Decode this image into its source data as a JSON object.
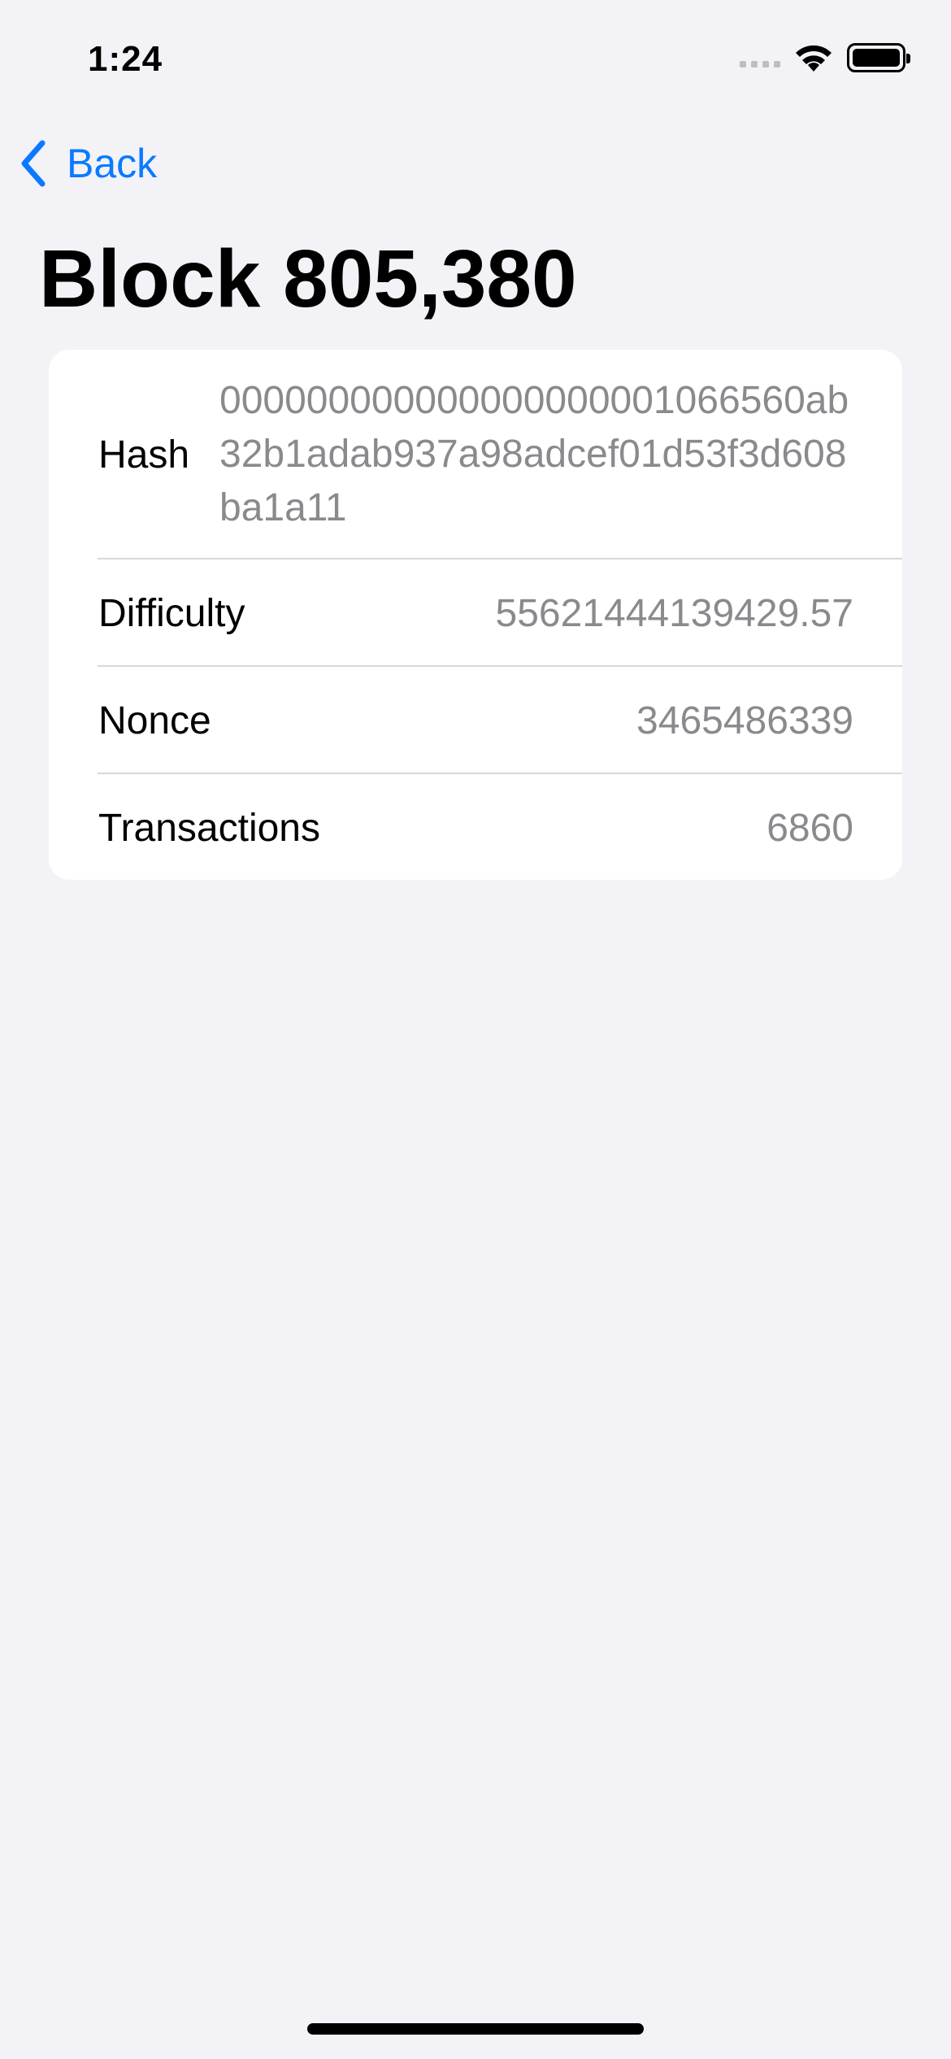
{
  "status_bar": {
    "time": "1:24"
  },
  "nav": {
    "back_label": "Back"
  },
  "title": "Block 805,380",
  "details": [
    {
      "label": "Hash",
      "value": "000000000000000000001066560ab32b1adab937a98adcef01d53f3d608ba1a11"
    },
    {
      "label": "Difficulty",
      "value": "55621444139429.57"
    },
    {
      "label": "Nonce",
      "value": "3465486339"
    },
    {
      "label": "Transactions",
      "value": "6860"
    }
  ],
  "colors": {
    "accent": "#0A7AFF",
    "background": "#F2F2F7",
    "secondary_text": "#8A8A8E"
  }
}
